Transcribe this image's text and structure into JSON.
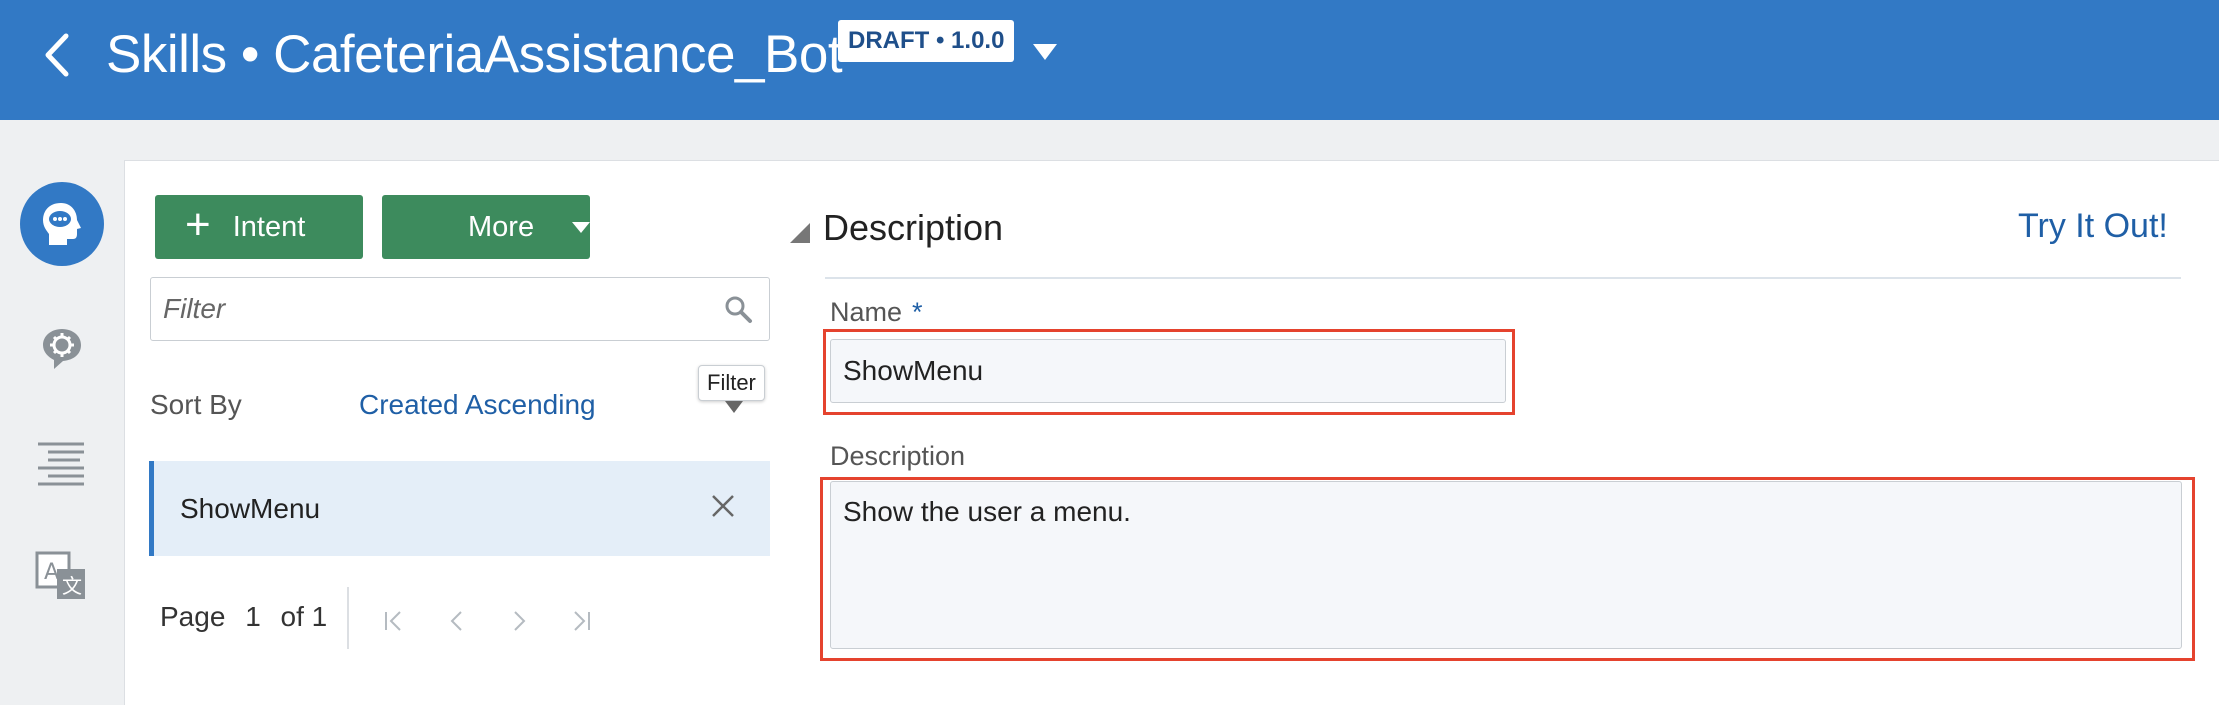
{
  "header": {
    "title": "Skills • CafeteriaAssistance_Bot",
    "version_badge": "DRAFT • 1.0.0",
    "brand_color": "#3279c5"
  },
  "rail": {
    "items": [
      {
        "icon": "intents-icon",
        "active": true
      },
      {
        "icon": "entities-icon",
        "active": false
      },
      {
        "icon": "flows-icon",
        "active": false
      },
      {
        "icon": "translate-icon",
        "active": false
      }
    ]
  },
  "toolbar": {
    "add_intent_label": "Intent",
    "more_label": "More"
  },
  "filter": {
    "placeholder": "Filter",
    "tooltip": "Filter"
  },
  "sort": {
    "label": "Sort By",
    "value": "Created Ascending"
  },
  "intents": [
    {
      "name": "ShowMenu",
      "selected": true
    }
  ],
  "pagination": {
    "page_label": "Page",
    "current": "1",
    "of_label": "of 1"
  },
  "detail": {
    "section_title": "Description",
    "try_it_label": "Try It Out!",
    "name_label": "Name",
    "required_mark": "*",
    "name_value": "ShowMenu",
    "description_label": "Description",
    "description_value": "Show the user a menu."
  },
  "highlight_color": "#e5432e",
  "action_color": "#3d8b5d"
}
